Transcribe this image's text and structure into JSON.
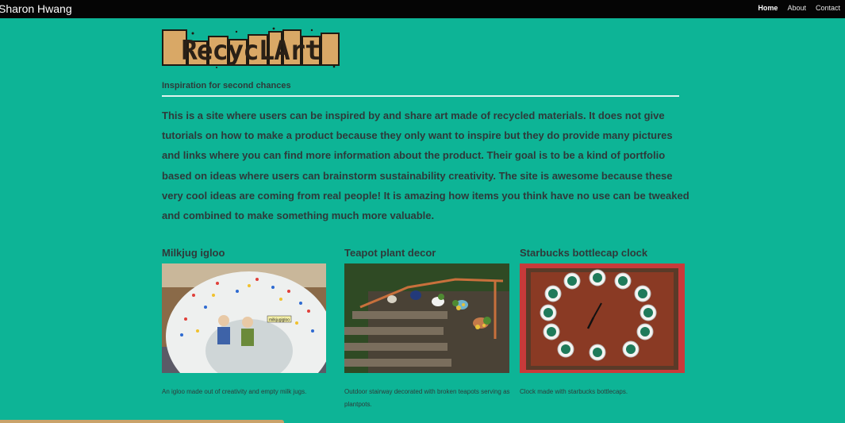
{
  "header": {
    "brand": "Sharon Hwang",
    "nav": [
      {
        "label": "Home",
        "active": true
      },
      {
        "label": "About",
        "active": false
      },
      {
        "label": "Contact",
        "active": false
      }
    ]
  },
  "logo_text": "RecycLArt",
  "tagline": "Inspiration for second chances",
  "intro": "This is a site where users can be inspired by and share art made of recycled materials. It does not give tutorials on how to make a product because they only want to inspire but they do provide many pictures and links where you can find more information about the product. Their goal is to be a kind of portfolio based on ideas where users can brainstorm sustainability creativity. The site is awesome because these very cool ideas are coming from real people! It is amazing how items you think have no use can be tweaked and combined to make something much more valuable.",
  "cards": [
    {
      "title": "Milkjug igloo",
      "caption": "An igloo made out of creativity and empty milk jugs.",
      "photo_label": "milkjugigloo"
    },
    {
      "title": "Teapot plant decor",
      "caption": "Outdoor stairway decorated with broken teapots serving as plantpots."
    },
    {
      "title": "Starbucks bottlecap clock",
      "caption": "Clock made with starbucks bottlecaps."
    }
  ],
  "colors": {
    "background": "#0db496",
    "topbar": "#050505",
    "logo_fill": "#d9a866"
  }
}
